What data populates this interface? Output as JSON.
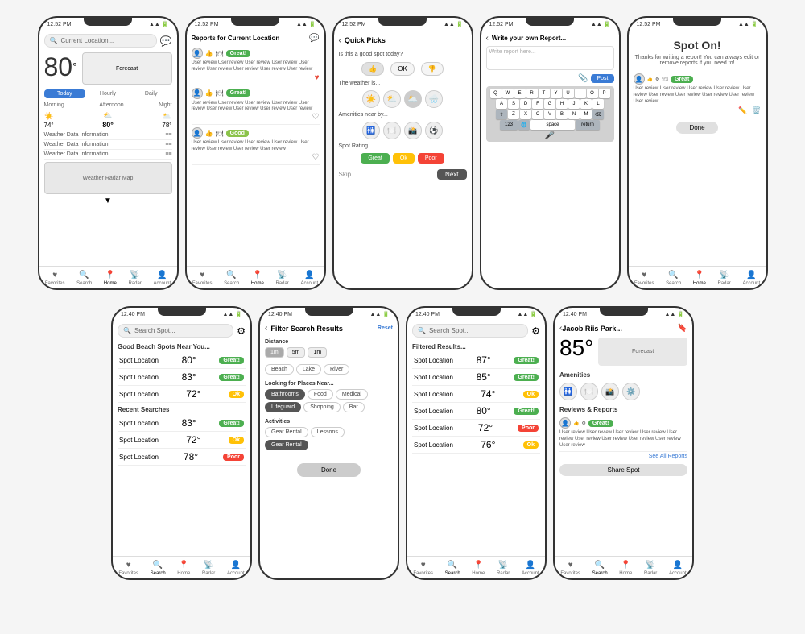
{
  "row1": {
    "screen1": {
      "status": "12:52 PM",
      "search_placeholder": "Current Location...",
      "temp": "80",
      "forecast_label": "Forecast",
      "tabs": [
        "Today",
        "Hourly",
        "Daily"
      ],
      "active_tab": 0,
      "time_labels": [
        "Morning",
        "Afternoon",
        "Night"
      ],
      "temps": [
        "74°",
        "80°",
        "78°"
      ],
      "weather_icons": [
        "☀️",
        "⛅",
        "🌥️"
      ],
      "data_rows": [
        "Weather Data Information",
        "Weather Data Information",
        "Weather Data Information"
      ],
      "radar_label": "Weather Radar Map",
      "nav": [
        "Favorites",
        "Search",
        "Home",
        "Radar",
        "Account"
      ]
    },
    "screen2": {
      "status": "12:52 PM",
      "title": "Reports for Current Location",
      "badge1": "Great!",
      "badge2": "Great!",
      "badge3": "Good",
      "report_text": "User review User review User review User review User review User review User review User review User review User review User review",
      "nav": [
        "Favorites",
        "Search",
        "Home",
        "Radar",
        "Account"
      ]
    },
    "screen3": {
      "status": "12:52 PM",
      "title": "Quick Picks",
      "question1": "Is this a good spot today?",
      "ok_label": "OK",
      "question2": "The weather is...",
      "weather_opts": [
        "☀️",
        "⛅",
        "🌥️",
        "🌧️"
      ],
      "question3": "Amenities near by...",
      "amenities": [
        "🚻",
        "🍽️",
        "📸",
        "⚽"
      ],
      "question4": "Spot Rating...",
      "rating_btns": [
        "Great",
        "Ok",
        "Poor"
      ],
      "skip_label": "Skip",
      "next_label": "Next"
    },
    "screen4": {
      "status": "12:52 PM",
      "title": "Write your own Report...",
      "placeholder": "Write report here...",
      "post_label": "Post",
      "keyboard_rows": [
        [
          "Q",
          "W",
          "E",
          "R",
          "T",
          "Y",
          "U",
          "I",
          "O",
          "P"
        ],
        [
          "A",
          "S",
          "D",
          "F",
          "G",
          "H",
          "J",
          "K",
          "L"
        ],
        [
          "⇧",
          "Z",
          "X",
          "C",
          "V",
          "B",
          "N",
          "M",
          "⌫"
        ],
        [
          "123",
          "🌐",
          "space",
          "return"
        ]
      ]
    },
    "screen5": {
      "status": "12:52 PM",
      "title": "Spot On!",
      "message": "Thanks for writing a report! You can always edit or remove reports if you need to!",
      "badge": "Great",
      "review_text": "User review User review User review User review User review User review User review User review User review User review",
      "done_label": "Done",
      "nav": [
        "Favorites",
        "Search",
        "Home",
        "Radar",
        "Account"
      ]
    }
  },
  "row2": {
    "screen6": {
      "status": "12:40 PM",
      "search_placeholder": "Search Spot...",
      "section1": "Good Beach Spots Near You...",
      "spots1": [
        {
          "name": "Spot Location",
          "temp": "80°",
          "badge": "Great!",
          "badge_type": "great"
        },
        {
          "name": "Spot Location",
          "temp": "83°",
          "badge": "Great!",
          "badge_type": "great"
        },
        {
          "name": "Spot Location",
          "temp": "72°",
          "badge": "Ok",
          "badge_type": "ok"
        }
      ],
      "section2": "Recent Searches",
      "spots2": [
        {
          "name": "Spot Location",
          "temp": "83°",
          "badge": "Great!",
          "badge_type": "great"
        },
        {
          "name": "Spot Location",
          "temp": "72°",
          "badge": "Ok",
          "badge_type": "ok"
        },
        {
          "name": "Spot Location",
          "temp": "78°",
          "badge": "Poor",
          "badge_type": "poor"
        }
      ],
      "nav": [
        "Favorites",
        "Search",
        "Home",
        "Radar",
        "Account"
      ]
    },
    "screen7": {
      "status": "12:40 PM",
      "title": "Filter Search Results",
      "reset_label": "Reset",
      "distance_label": "Distance",
      "distances": [
        "1m",
        "5m",
        "1m"
      ],
      "active_distance": 0,
      "water_types": [
        "Beach",
        "Lake",
        "River"
      ],
      "looking_label": "Looking for Places Near...",
      "amenities": [
        "Bathrooms",
        "Food",
        "Medical",
        "Lifeguard",
        "Shopping",
        "Bar"
      ],
      "selected_amenities": [
        "Bathrooms",
        "Lifeguard"
      ],
      "activities_label": "Activities",
      "activities": [
        "Gear Rental",
        "Lessons",
        "Gear Rental"
      ],
      "done_label": "Done"
    },
    "screen8": {
      "status": "12:40 PM",
      "search_placeholder": "Search Spot...",
      "results_label": "Filtered Results...",
      "spots": [
        {
          "name": "Spot Location",
          "temp": "87°",
          "badge": "Great!",
          "badge_type": "great"
        },
        {
          "name": "Spot Location",
          "temp": "85°",
          "badge": "Great!",
          "badge_type": "great"
        },
        {
          "name": "Spot Location",
          "temp": "74°",
          "badge": "Ok",
          "badge_type": "ok"
        },
        {
          "name": "Spot Location",
          "temp": "80°",
          "badge": "Great!",
          "badge_type": "great"
        },
        {
          "name": "Spot Location",
          "temp": "72°",
          "badge": "Poor",
          "badge_type": "poor"
        },
        {
          "name": "Spot Location",
          "temp": "76°",
          "badge": "Ok",
          "badge_type": "ok"
        }
      ],
      "nav": [
        "Favorites",
        "Search",
        "Home",
        "Radar",
        "Account"
      ]
    },
    "screen9": {
      "status": "12:40 PM",
      "title": "Jacob Riis Park...",
      "temp": "85°",
      "forecast_label": "Forecast",
      "amenities_label": "Amenities",
      "amenities": [
        "🚻",
        "🍽️",
        "📸",
        "⚙️"
      ],
      "reviews_label": "Reviews & Reports",
      "badge": "Great!",
      "review_text": "User review User review User review User review User review User review User review User review User review User review User review User review",
      "see_all": "See All Reports",
      "share_label": "Share Spot",
      "nav": [
        "Favorites",
        "Search",
        "Home",
        "Radar",
        "Account"
      ]
    }
  },
  "icons": {
    "search": "🔍",
    "chat": "💬",
    "heart": "♡",
    "back": "‹",
    "settings": "⚙",
    "thumbsup": "👍",
    "thumbsdown": "👎",
    "fork": "🍽",
    "star": "★",
    "home": "⌂",
    "account": "👤",
    "radar": "📡",
    "favorites": "♥",
    "location": "📍"
  }
}
